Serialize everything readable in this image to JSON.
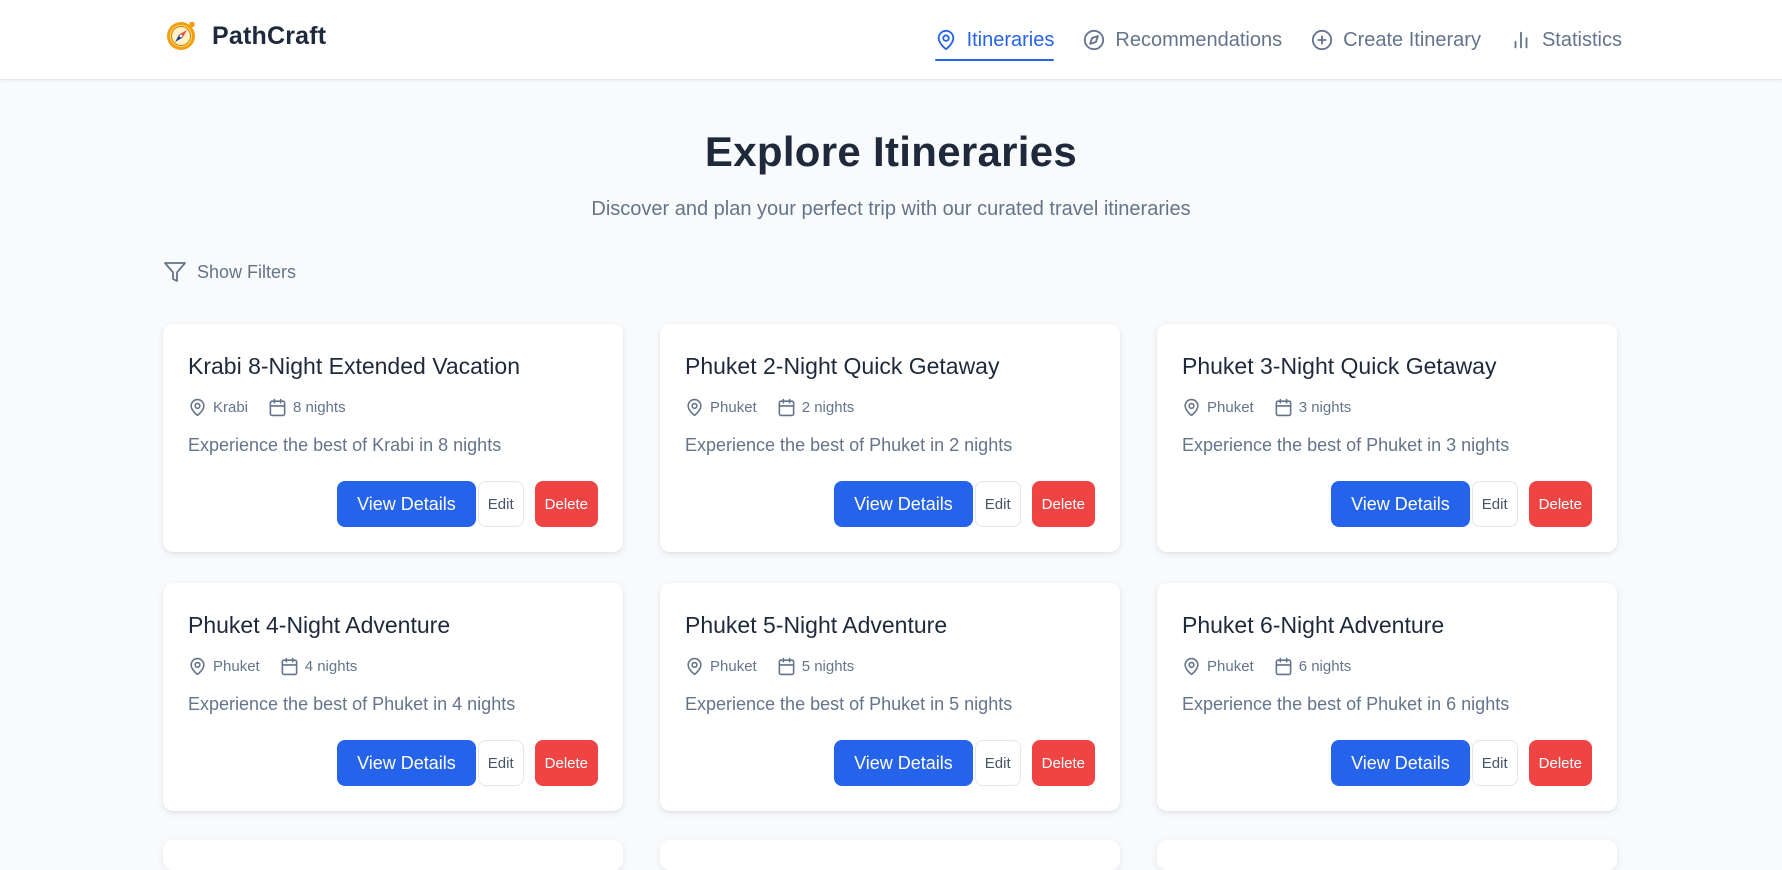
{
  "app": {
    "name": "PathCraft",
    "logo_icon": "compass-logo-icon"
  },
  "nav": [
    {
      "label": "Itineraries",
      "icon": "map-pin-icon",
      "active": true
    },
    {
      "label": "Recommendations",
      "icon": "compass-icon",
      "active": false
    },
    {
      "label": "Create Itinerary",
      "icon": "plus-circle-icon",
      "active": false
    },
    {
      "label": "Statistics",
      "icon": "bar-chart-icon",
      "active": false
    }
  ],
  "hero": {
    "title": "Explore Itineraries",
    "subtitle": "Discover and plan your perfect trip with our curated travel itineraries"
  },
  "filters": {
    "label": "Show Filters",
    "icon": "filter-icon"
  },
  "buttons": {
    "view": "View Details",
    "edit": "Edit",
    "delete": "Delete"
  },
  "itineraries": [
    {
      "title": "Krabi 8-Night Extended Vacation",
      "location": "Krabi",
      "nights": "8 nights",
      "description": "Experience the best of Krabi in 8 nights"
    },
    {
      "title": "Phuket 2-Night Quick Getaway",
      "location": "Phuket",
      "nights": "2 nights",
      "description": "Experience the best of Phuket in 2 nights"
    },
    {
      "title": "Phuket 3-Night Quick Getaway",
      "location": "Phuket",
      "nights": "3 nights",
      "description": "Experience the best of Phuket in 3 nights"
    },
    {
      "title": "Phuket 4-Night Adventure",
      "location": "Phuket",
      "nights": "4 nights",
      "description": "Experience the best of Phuket in 4 nights"
    },
    {
      "title": "Phuket 5-Night Adventure",
      "location": "Phuket",
      "nights": "5 nights",
      "description": "Experience the best of Phuket in 5 nights"
    },
    {
      "title": "Phuket 6-Night Adventure",
      "location": "Phuket",
      "nights": "6 nights",
      "description": "Experience the best of Phuket in 6 nights"
    }
  ],
  "colors": {
    "primary": "#2563eb",
    "danger": "#ef4444",
    "text": "#1e293b",
    "muted": "#64748b",
    "background": "#f8fafc"
  }
}
